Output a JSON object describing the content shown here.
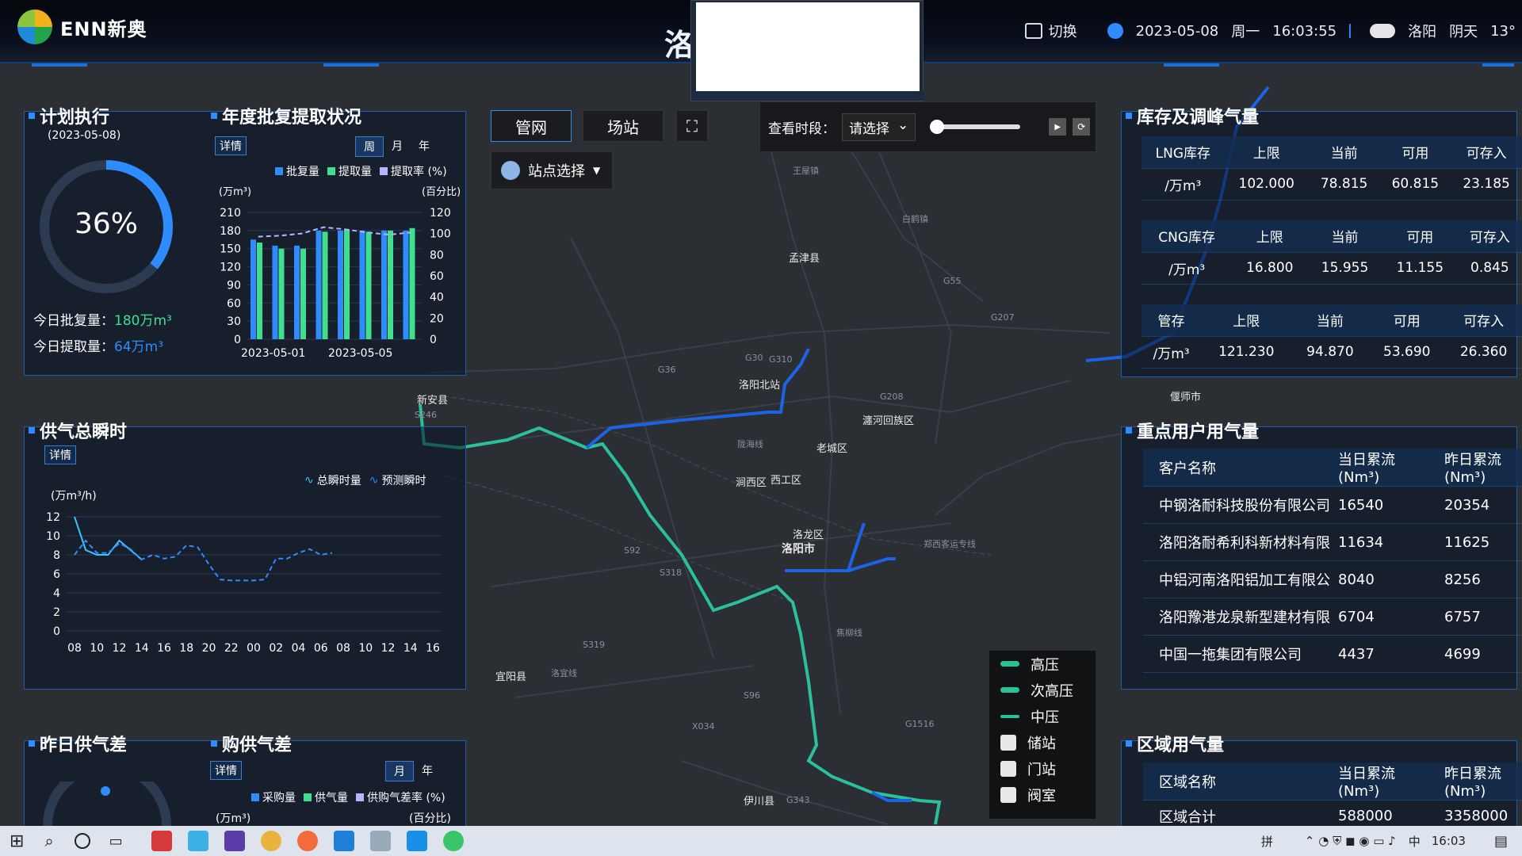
{
  "header": {
    "brand": "ENN新奥",
    "title_fragment": "洛",
    "switch_label": "切换",
    "date": "2023-05-08",
    "weekday": "周一",
    "time": "16:03:55",
    "city": "洛阳",
    "weather": "阴天",
    "temp": "13°"
  },
  "map_controls": {
    "tab_pipe": "管网",
    "tab_station": "场站",
    "station_select": "站点选择",
    "period_label": "查看时段：",
    "period_placeholder": "请选择"
  },
  "map_legend": {
    "items": [
      "高压",
      "次高压",
      "中压",
      "储站",
      "门站",
      "阀室"
    ]
  },
  "map_labels": [
    "孟津县",
    "新安县",
    "洛阳北站",
    "瀍河回族区",
    "老城区",
    "涧西区",
    "西工区",
    "洛龙区",
    "洛阳市",
    "宜阳县",
    "伊川县",
    "偃师市",
    "王屋镇",
    "白鹤镇",
    "G30",
    "G310",
    "G36",
    "G55",
    "G207",
    "G208",
    "S92",
    "S318",
    "S319",
    "G1516",
    "X034",
    "S96",
    "G343",
    "S246",
    "陇海线",
    "郑西客运专线",
    "洛宜线",
    "焦柳线"
  ],
  "plan": {
    "title": "计划执行",
    "date": "(2023-05-08)",
    "percent": "36%",
    "percent_value": 36,
    "approved_label": "今日批复量：",
    "approved_value": "180万m³",
    "extracted_label": "今日提取量：",
    "extracted_value": "64万m³"
  },
  "annual": {
    "title": "年度批复提取状况",
    "detail": "详情",
    "tabs": [
      "周",
      "月",
      "年"
    ],
    "active_tab": "周",
    "legend": [
      "批复量",
      "提取量",
      "提取率 (%)"
    ],
    "yunit_left": "(万m³)",
    "yunit_right": "(百分比)"
  },
  "supply": {
    "title": "供气总瞬时",
    "detail": "详情",
    "unit": "(万m³/h)",
    "legend": [
      "总瞬时量",
      "预测瞬时"
    ]
  },
  "yesterday": {
    "title": "昨日供气差",
    "title2": "购供气差",
    "detail": "详情",
    "tabs": [
      "月",
      "年"
    ],
    "active_tab": "月",
    "legend": [
      "采购量",
      "供气量",
      "供购气差率 (%)"
    ],
    "yunit_left": "(万m³)",
    "yunit_right": "(百分比)"
  },
  "storage": {
    "title": "库存及调峰气量",
    "blocks": [
      {
        "name": "LNG库存",
        "unit": "/万m³",
        "cols": [
          "上限",
          "当前",
          "可用",
          "可存入"
        ],
        "vals": [
          "102.000",
          "78.815",
          "60.815",
          "23.185"
        ]
      },
      {
        "name": "CNG库存",
        "unit": "/万m³",
        "cols": [
          "上限",
          "当前",
          "可用",
          "可存入"
        ],
        "vals": [
          "16.800",
          "15.955",
          "11.155",
          "0.845"
        ]
      },
      {
        "name": "管存",
        "unit": "/万m³",
        "cols": [
          "上限",
          "当前",
          "可用",
          "可存入"
        ],
        "vals": [
          "121.230",
          "94.870",
          "53.690",
          "26.360"
        ]
      }
    ]
  },
  "keyusers": {
    "title": "重点用户用气量",
    "cols": [
      "客户名称",
      "当日累流(Nm³)",
      "昨日累流(Nm³)"
    ],
    "rows": [
      [
        "中钢洛耐科技股份有限公司",
        "16540",
        "20354"
      ],
      [
        "洛阳洛耐希利科新材料有限",
        "11634",
        "11625"
      ],
      [
        "中铝河南洛阳铝加工有限公",
        "8040",
        "8256"
      ],
      [
        "洛阳豫港龙泉新型建材有限",
        "6704",
        "6757"
      ],
      [
        "中国一拖集团有限公司",
        "4437",
        "4699"
      ]
    ]
  },
  "region": {
    "title": "区域用气量",
    "cols": [
      "区域名称",
      "当日累流(Nm³)",
      "昨日累流(Nm³)"
    ],
    "rows": [
      [
        "区域合计",
        "588000",
        "3358000"
      ]
    ]
  },
  "taskbar": {
    "ime": "中",
    "clock": "16:03",
    "ime2": "拼"
  },
  "chart_data": [
    {
      "type": "bar",
      "title": "年度批复提取状况",
      "categories": [
        "2023-05-01",
        "2023-05-02",
        "2023-05-03",
        "2023-05-04",
        "2023-05-05",
        "2023-05-06",
        "2023-05-07",
        "2023-05-08"
      ],
      "x_tick_labels": [
        "2023-05-01",
        "2023-05-05"
      ],
      "series": [
        {
          "name": "批复量",
          "values": [
            165,
            155,
            155,
            180,
            180,
            180,
            180,
            180
          ]
        },
        {
          "name": "提取量",
          "values": [
            160,
            150,
            150,
            178,
            182,
            178,
            180,
            184
          ]
        },
        {
          "name": "提取率 (%)",
          "values": [
            97,
            98,
            100,
            106,
            104,
            101,
            99,
            101
          ]
        }
      ],
      "ylim": [
        0,
        210
      ],
      "yticks": [
        "0",
        "30",
        "60",
        "90",
        "120",
        "150",
        "180",
        "210"
      ],
      "ylim_right": [
        0,
        120
      ],
      "yticks_right": [
        "0",
        "20",
        "40",
        "60",
        "80",
        "100",
        "120"
      ]
    },
    {
      "type": "line",
      "title": "供气总瞬时",
      "x": [
        "08",
        "09",
        "10",
        "11",
        "12",
        "13",
        "14",
        "15",
        "16",
        "17",
        "18",
        "19",
        "20",
        "21",
        "22",
        "23",
        "00",
        "01",
        "02",
        "03",
        "04",
        "05",
        "06",
        "07",
        "08",
        "09",
        "10",
        "11",
        "12",
        "13",
        "14",
        "15",
        "16"
      ],
      "x_tick_labels": [
        "08",
        "10",
        "12",
        "14",
        "16",
        "18",
        "20",
        "22",
        "00",
        "02",
        "04",
        "06",
        "08",
        "10",
        "12",
        "14",
        "16"
      ],
      "series": [
        {
          "name": "总瞬时量",
          "values": [
            12,
            8.5,
            8,
            8,
            9.5,
            8.5,
            7.5
          ]
        },
        {
          "name": "预测瞬时",
          "values": [
            8,
            9.5,
            8.2,
            8.2,
            9.2,
            8.6,
            7.5,
            8,
            7.6,
            7.8,
            9,
            8.8,
            7,
            5.4,
            5.3,
            5.3,
            5.3,
            5.4,
            7.6,
            7.6,
            8.2,
            8.6,
            8,
            8.2
          ]
        }
      ],
      "ylim": [
        0,
        12
      ],
      "yticks": [
        "0",
        "2",
        "4",
        "6",
        "8",
        "10",
        "12"
      ]
    }
  ]
}
